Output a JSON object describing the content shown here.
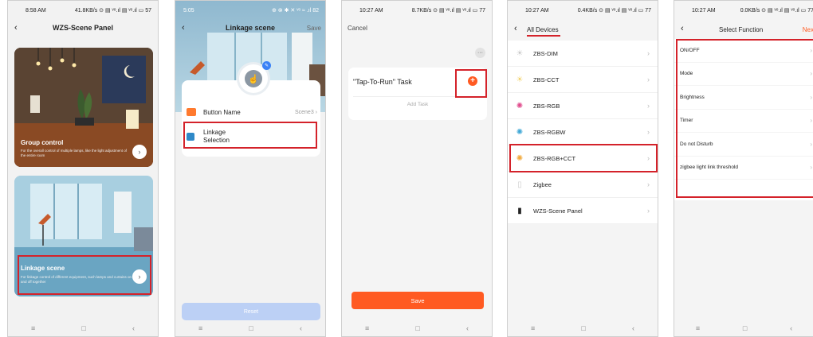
{
  "phone1": {
    "status_time": "8:58 AM",
    "status_right": "41.8KB/s ⊙ ▤ ᵛᵒ.ıl ▤ ᵛᵒ.ıl ▭ 57",
    "title": "WZS-Scene Panel",
    "back_icon": "‹",
    "group_title": "Group control",
    "group_desc": "For the overall control of multiple lamps, like the light adjustment of the entire room",
    "linkage_title": "Linkage scene",
    "linkage_desc": "For linkage control of different equipment, such lamps and curtains on and off together",
    "arrow": "›",
    "nav": [
      "≡",
      "□",
      "‹"
    ]
  },
  "phone2": {
    "status_time": "5:05",
    "status_right": "⊕ ⊗ ✱ ✕ ᵛᵒ ≈ .ıl 82",
    "title": "Linkage scene",
    "save": "Save",
    "back_icon": "‹",
    "button_name_label": "Button Name",
    "button_name_value": "Scene3 ›",
    "linkage_label": "Linkage\nSelection",
    "linkage_chev": "›",
    "reset": "Reset",
    "nav": [
      "≡",
      "□",
      "‹"
    ]
  },
  "phone3": {
    "status_time": "10:27 AM",
    "status_right": "8.7KB/s ⊙ ▤ ᵛᵒ.ıl ▤ ᵛᵒ.ıl ▭ 77",
    "cancel": "Cancel",
    "more": "···",
    "task_title": "\"Tap-To-Run\" Task",
    "plus": "+",
    "add_task": "Add Task",
    "save": "Save",
    "nav": [
      "≡",
      "□",
      "‹"
    ]
  },
  "phone4": {
    "status_time": "10:27 AM",
    "status_right": "0.4KB/s ⊙ ▤ ᵛᵒ.ıl ▤ ᵛᵒ.ıl ▭ 77",
    "back_icon": "‹",
    "tab": "All Devices",
    "devices": [
      {
        "label": "ZBS-DIM",
        "icon": "☀",
        "color": "#c9c9c9"
      },
      {
        "label": "ZBS-CCT",
        "icon": "☀",
        "color": "#f1d26a"
      },
      {
        "label": "ZBS-RGB",
        "icon": "✺",
        "color": "#e04b8c"
      },
      {
        "label": "ZBS-RGBW",
        "icon": "✺",
        "color": "#3fa7d6"
      },
      {
        "label": "ZBS-RGB+CCT",
        "icon": "✺",
        "color": "#f2a93b"
      },
      {
        "label": "Zigbee",
        "icon": "▯",
        "color": "#cccccc"
      },
      {
        "label": "WZS-Scene Panel",
        "icon": "▮",
        "color": "#222222"
      }
    ],
    "chev": "›",
    "nav": [
      "≡",
      "□",
      "‹"
    ]
  },
  "phone5": {
    "status_time": "10:27 AM",
    "status_right": "0.0KB/s ⊙ ▤ ᵛᵒ.ıl ▤ ᵛᵒ.ıl ▭ 77",
    "back_icon": "‹",
    "title": "Select Function",
    "next": "Nex",
    "functions": [
      "ON/OFF",
      "Mode",
      "Brightness",
      "Timer",
      "Do not Disturb",
      "zigbee light link threshold"
    ],
    "chev": "›",
    "nav": [
      "≡",
      "□",
      "‹"
    ]
  },
  "colors": {
    "accent_red": "#d4222a",
    "orange": "#ff5a22",
    "linkage_blue": "#2f89c8"
  }
}
